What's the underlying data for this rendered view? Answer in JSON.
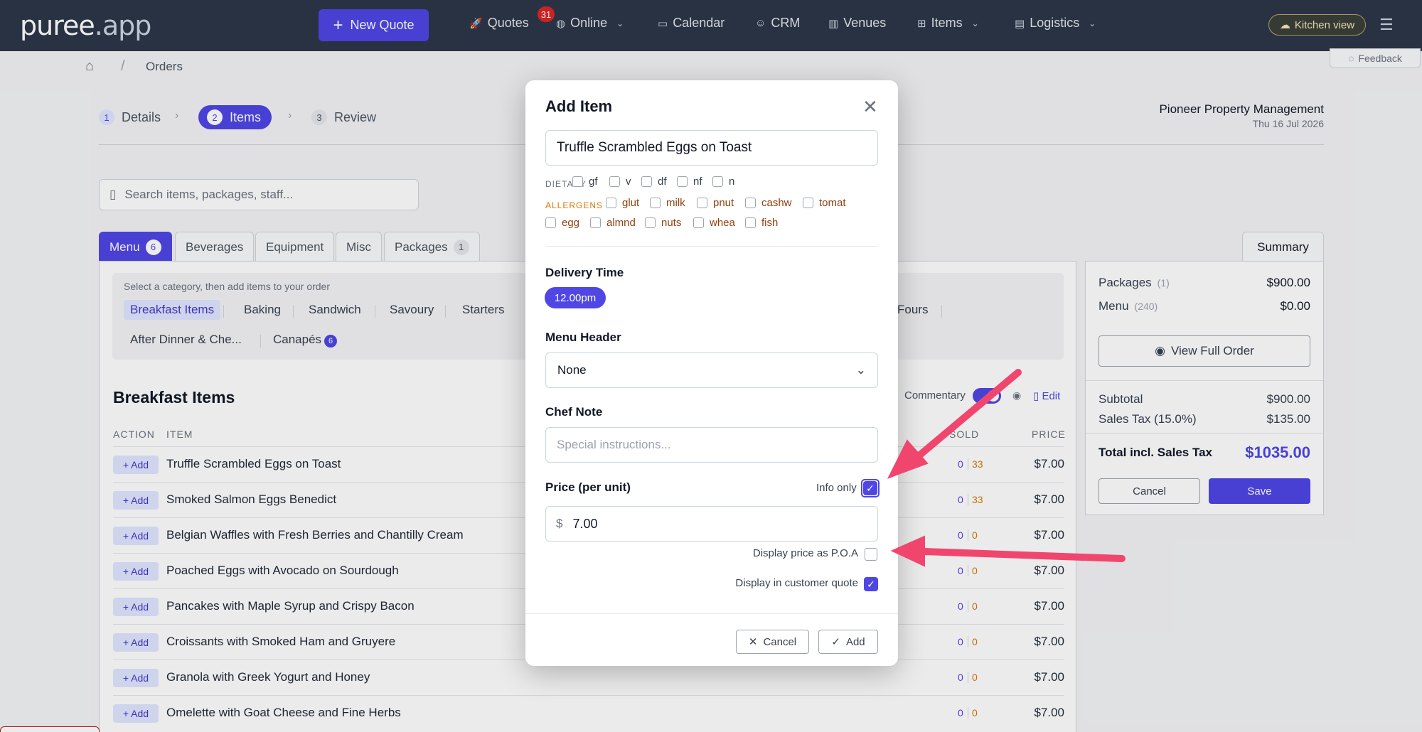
{
  "app": {
    "logo_main": "puree",
    "logo_dim": ".app"
  },
  "topnav": {
    "new_quote": "New Quote",
    "quotes": "Quotes",
    "quotes_badge": "31",
    "online": "Online",
    "calendar": "Calendar",
    "crm": "CRM",
    "venues": "Venues",
    "items": "Items",
    "logistics": "Logistics",
    "kitchen_view": "Kitchen view"
  },
  "breadcrumb": {
    "current": "Orders"
  },
  "feedback": "Feedback",
  "steps": [
    {
      "num": "1",
      "label": "Details"
    },
    {
      "num": "2",
      "label": "Items"
    },
    {
      "num": "3",
      "label": "Review"
    }
  ],
  "client": {
    "name": "Pioneer Property Management",
    "date": "Thu 16 Jul 2026"
  },
  "search": {
    "placeholder": "Search items, packages, staff..."
  },
  "tabs": [
    {
      "label": "Menu",
      "count": "6"
    },
    {
      "label": "Beverages"
    },
    {
      "label": "Equipment"
    },
    {
      "label": "Misc"
    },
    {
      "label": "Packages",
      "count": "1"
    }
  ],
  "categories": {
    "hint": "Select a category, then add items to your order",
    "items": [
      "Breakfast Items",
      "Baking",
      "Sandwich",
      "Savoury",
      "Starters",
      "Fours",
      "After Dinner & Che...",
      "Canapés"
    ],
    "canapes_badge": "6"
  },
  "section": {
    "title": "Breakfast Items",
    "commentary": "Commentary",
    "edit": "Edit",
    "col_action": "ACTION",
    "col_item": "ITEM",
    "col_sold": "SOLD",
    "col_price": "PRICE",
    "add_label": "+ Add"
  },
  "rows": [
    {
      "name": "Truffle Scrambled Eggs on Toast",
      "s1": "0",
      "s2": "33",
      "price": "$7.00"
    },
    {
      "name": "Smoked Salmon Eggs Benedict",
      "s1": "0",
      "s2": "33",
      "price": "$7.00"
    },
    {
      "name": "Belgian Waffles with Fresh Berries and Chantilly Cream",
      "s1": "0",
      "s2": "0",
      "price": "$7.00"
    },
    {
      "name": "Poached Eggs with Avocado on Sourdough",
      "s1": "0",
      "s2": "0",
      "price": "$7.00"
    },
    {
      "name": "Pancakes with Maple Syrup and Crispy Bacon",
      "s1": "0",
      "s2": "0",
      "price": "$7.00"
    },
    {
      "name": "Croissants with Smoked Ham and Gruyere",
      "s1": "0",
      "s2": "0",
      "price": "$7.00"
    },
    {
      "name": "Granola with Greek Yogurt and Honey",
      "s1": "0",
      "s2": "0",
      "price": "$7.00"
    },
    {
      "name": "Omelette with Goat Cheese and Fine Herbs",
      "s1": "0",
      "s2": "0",
      "price": "$7.00"
    }
  ],
  "summary": {
    "tab": "Summary",
    "packages_label": "Packages",
    "packages_count": "(1)",
    "packages_value": "$900.00",
    "menu_label": "Menu",
    "menu_count": "(240)",
    "menu_value": "$0.00",
    "view_full": "View Full Order",
    "subtotal_label": "Subtotal",
    "subtotal_value": "$900.00",
    "tax_label": "Sales Tax (15.0%)",
    "tax_value": "$135.00",
    "total_label": "Total incl. Sales Tax",
    "total_value": "$1035.00",
    "cancel": "Cancel",
    "save": "Save"
  },
  "modal": {
    "title": "Add Item",
    "item_name": "Truffle Scrambled Eggs on Toast",
    "dietary_label": "DIETARY",
    "dietary": [
      "gf",
      "v",
      "df",
      "nf",
      "n"
    ],
    "allergens_label": "ALLERGENS",
    "allergens_row1": [
      "glut",
      "milk",
      "pnut",
      "cashw",
      "tomat"
    ],
    "allergens_row2": [
      "egg",
      "almnd",
      "nuts",
      "whea",
      "fish"
    ],
    "delivery_label": "Delivery Time",
    "delivery_value": "12.00pm",
    "menu_header_label": "Menu Header",
    "menu_header_value": "None",
    "chef_note_label": "Chef Note",
    "chef_note_placeholder": "Special instructions...",
    "price_label": "Price (per unit)",
    "info_only_label": "Info only",
    "info_only_checked": true,
    "currency": "$",
    "price_value": "7.00",
    "poa_label": "Display price as P.O.A",
    "poa_checked": false,
    "customer_quote_label": "Display in customer quote",
    "customer_quote_checked": true,
    "cancel": "Cancel",
    "add": "Add"
  },
  "colors": {
    "accent": "#4f46e5",
    "topbar": "#2d3748",
    "arrow": "#f0466e"
  }
}
